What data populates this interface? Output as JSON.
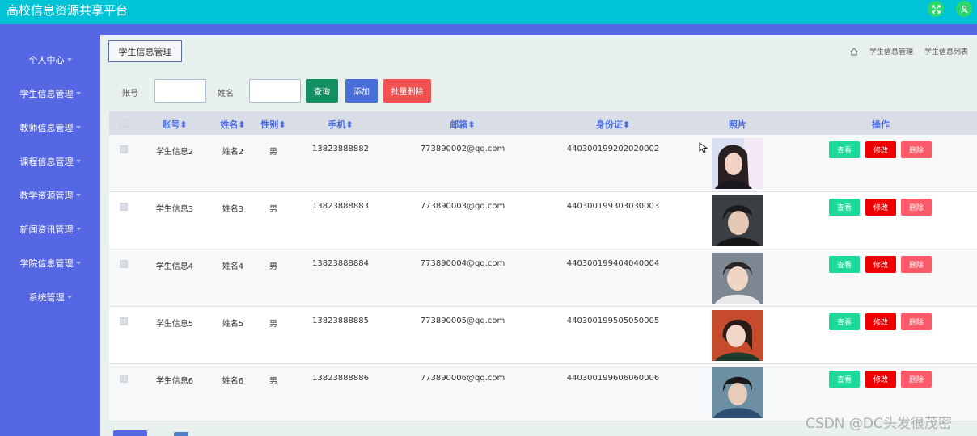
{
  "app": {
    "title": "高校信息资源共享平台"
  },
  "header": {
    "fullscreen_icon": "expand-icon",
    "user_icon": "user-icon",
    "button_color": "#2bd66d"
  },
  "colors": {
    "topbar": "#00c4d6",
    "sidebar": "#5667e4",
    "header_text": "#4a6ce0",
    "view": "#1fd99a",
    "edit": "#ee0000",
    "delete": "#fc5a69"
  },
  "sidebar": {
    "items": [
      {
        "label": "个人中心"
      },
      {
        "label": "学生信息管理"
      },
      {
        "label": "教师信息管理"
      },
      {
        "label": "课程信息管理"
      },
      {
        "label": "教学资源管理"
      },
      {
        "label": "新闻资讯管理"
      },
      {
        "label": "学院信息管理"
      },
      {
        "label": "系统管理"
      }
    ]
  },
  "tab": {
    "label": "学生信息管理"
  },
  "breadcrumb": {
    "home_icon": "home-icon",
    "items": [
      "学生信息管理",
      "学生信息列表"
    ]
  },
  "search": {
    "account_label": "账号",
    "account_value": "",
    "name_label": "姓名",
    "name_value": "",
    "query_label": "查询",
    "add_label": "添加",
    "batch_delete_label": "批量删除"
  },
  "table": {
    "headers": [
      "账号",
      "姓名",
      "性别",
      "手机",
      "邮箱",
      "身份证",
      "照片",
      "操作"
    ],
    "rows": [
      {
        "account": "学生信息2",
        "name": "姓名2",
        "gender": "男",
        "phone": "13823888882",
        "email": "773890002@qq.com",
        "id_card": "440300199202020002",
        "photo": "student-photo"
      },
      {
        "account": "学生信息3",
        "name": "姓名3",
        "gender": "男",
        "phone": "13823888883",
        "email": "773890003@qq.com",
        "id_card": "440300199303030003",
        "photo": "student-photo"
      },
      {
        "account": "学生信息4",
        "name": "姓名4",
        "gender": "男",
        "phone": "13823888884",
        "email": "773890004@qq.com",
        "id_card": "440300199404040004",
        "photo": "student-photo"
      },
      {
        "account": "学生信息5",
        "name": "姓名5",
        "gender": "男",
        "phone": "13823888885",
        "email": "773890005@qq.com",
        "id_card": "440300199505050005",
        "photo": "student-photo"
      },
      {
        "account": "学生信息6",
        "name": "姓名6",
        "gender": "男",
        "phone": "13823888886",
        "email": "773890006@qq.com",
        "id_card": "440300199606060006",
        "photo": "student-photo"
      }
    ],
    "actions": {
      "view": "查看",
      "edit": "修改",
      "delete": "删除"
    }
  },
  "watermark": "CSDN @DC头发很茂密"
}
